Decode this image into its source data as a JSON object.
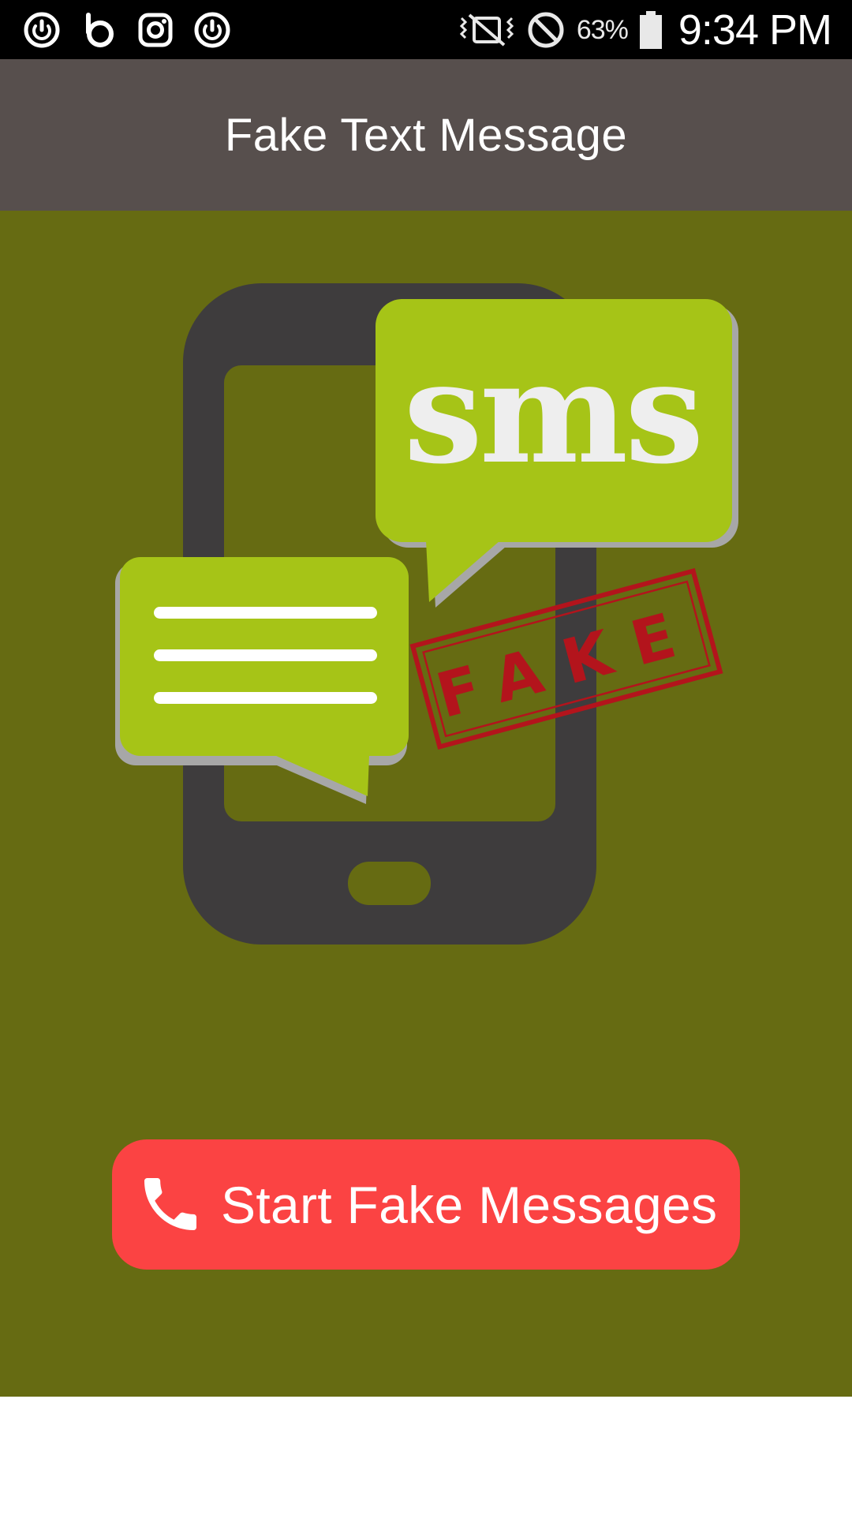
{
  "status_bar": {
    "left_icons": [
      "power-app-icon",
      "beats-icon",
      "instagram-icon",
      "power-app-icon"
    ],
    "right_icons": [
      "vibrate-icon",
      "do-not-disturb-icon",
      "battery-icon"
    ],
    "battery_percent": "63%",
    "time": "9:34 PM"
  },
  "app_bar": {
    "title": "Fake Text Message"
  },
  "illustration": {
    "sms_text": "sms",
    "stamp_text": "FAKE"
  },
  "main": {
    "start_button": {
      "label": "Start Fake Messages",
      "icon": "phone-icon"
    }
  },
  "colors": {
    "status_bar": "#000000",
    "app_bar": "#574f4d",
    "content_bg": "#666b12",
    "bubble_green": "#a6c417",
    "phone_dark": "#3e3c3d",
    "button_red": "#fb4343",
    "stamp_red": "#b3141c"
  }
}
